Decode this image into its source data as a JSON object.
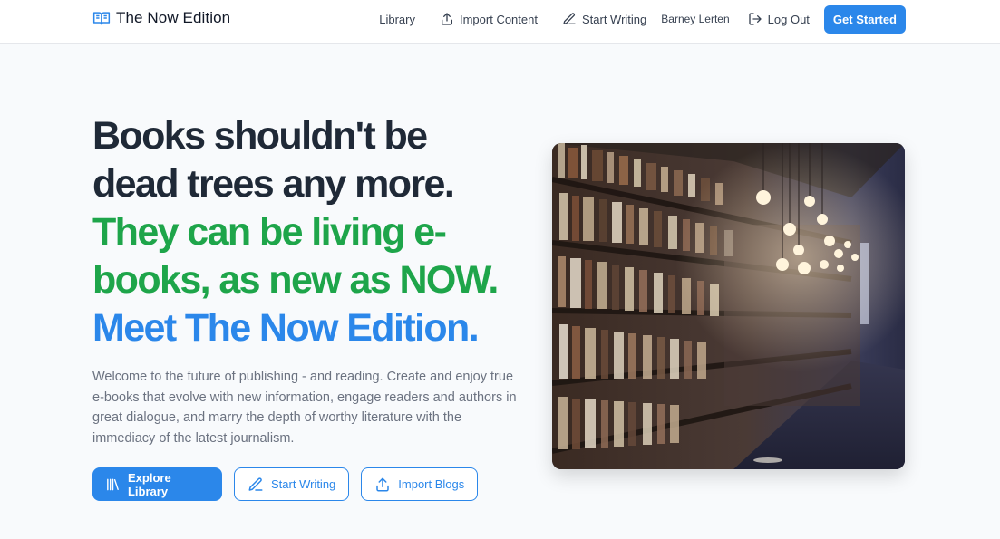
{
  "header": {
    "brand": "The Now Edition",
    "nav": {
      "library": "Library",
      "import": "Import Content",
      "write": "Start Writing",
      "user": "Barney Lerten",
      "logout": "Log Out",
      "cta": "Get Started"
    }
  },
  "hero": {
    "title_line1": "Books shouldn't be",
    "title_line2": "dead trees any more.",
    "title_line3": "They can be living e-",
    "title_line4": "books, as new as NOW.",
    "title_line5": "Meet The Now Edition.",
    "description": "Welcome to the future of publishing - and reading. Create and enjoy true e-books that evolve with new information, engage readers and authors in great dialogue, and marry the depth of worthy literature with the immediacy of the latest journalism.",
    "buttons": {
      "explore": "Explore Library",
      "write": "Start Writing",
      "import": "Import Blogs"
    }
  },
  "colors": {
    "primary": "#2b87ea",
    "green": "#1ea54a",
    "dark": "#1f2937",
    "muted": "#6b7280",
    "background": "#f8fafc"
  },
  "icons": {
    "brand": "open-book-icon",
    "import": "upload-icon",
    "write": "pencil-icon",
    "logout": "logout-icon",
    "library": "library-icon"
  }
}
